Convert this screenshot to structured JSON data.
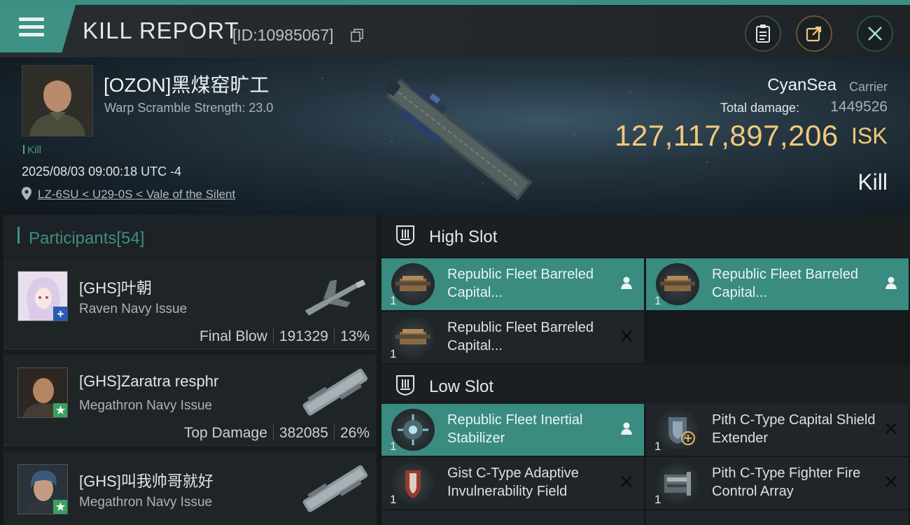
{
  "header": {
    "title": "KILL REPORT",
    "report_id": "[ID:10985067]"
  },
  "victim": {
    "name": "[OZON]黑煤窑旷工",
    "warp_scramble": "Warp Scramble Strength: 23.0",
    "kill_tag": "Kill",
    "datetime": "2025/08/03 09:00:18 UTC -4",
    "location": "LZ-6SU < U29-0S < Vale of the Silent"
  },
  "summary": {
    "attacker_corp": "CyanSea",
    "attacker_role": "Carrier",
    "total_damage_label": "Total damage:",
    "total_damage_value": "1449526",
    "isk_value": "127,117,897,206",
    "isk_unit": "ISK",
    "result": "Kill"
  },
  "participants": {
    "label": "Participants",
    "count": "[54]",
    "rows": [
      {
        "name": "[GHS]叶朝",
        "ship": "Raven Navy Issue",
        "role": "Final Blow",
        "damage": "191329",
        "percent": "13%",
        "badge": "+"
      },
      {
        "name": "[GHS]Zaratra resphr",
        "ship": "Megathron Navy Issue",
        "role": "Top Damage",
        "damage": "382085",
        "percent": "26%",
        "badge": "★"
      },
      {
        "name": "[GHS]叫我帅哥就好",
        "ship": "Megathron Navy Issue",
        "role": "",
        "damage": "",
        "percent": "",
        "badge": "★"
      }
    ]
  },
  "high_slot": {
    "title": "High Slot",
    "modules": [
      {
        "name": "Republic Fleet Barreled Capital...",
        "qty": "1",
        "status": "person-icon",
        "highlighted": true
      },
      {
        "name": "Republic Fleet Barreled Capital...",
        "qty": "1",
        "status": "person-icon",
        "highlighted": true
      },
      {
        "name": "Republic Fleet Barreled Capital...",
        "qty": "1",
        "status": "x-icon",
        "highlighted": false
      }
    ]
  },
  "low_slot": {
    "title": "Low Slot",
    "modules": [
      {
        "name": "Republic Fleet Inertial Stabilizer",
        "qty": "1",
        "status": "person-icon",
        "highlighted": true
      },
      {
        "name": "Pith C-Type Capital Shield Extender",
        "qty": "1",
        "status": "x-icon",
        "highlighted": false
      },
      {
        "name": "Gist C-Type Adaptive Invulnerability Field",
        "qty": "1",
        "status": "x-icon",
        "highlighted": false
      },
      {
        "name": "Pith C-Type Fighter Fire Control Array",
        "qty": "1",
        "status": "x-icon",
        "highlighted": false
      }
    ]
  },
  "colors": {
    "accent": "#3d9185",
    "isk_gold": "#f1c97a",
    "kill_green": "#4daa6a"
  }
}
